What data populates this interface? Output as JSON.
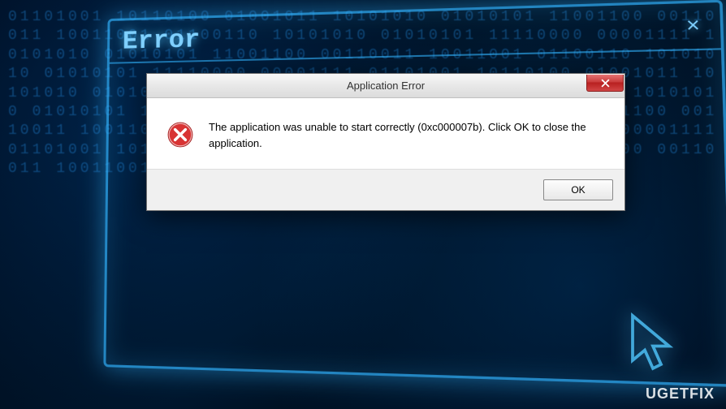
{
  "background": {
    "glow_title": "Error"
  },
  "dialog": {
    "title": "Application Error",
    "message": "The application was unable to start correctly (0xc000007b). Click OK to close the application.",
    "ok_label": "OK"
  },
  "watermark": "UGETFIX"
}
